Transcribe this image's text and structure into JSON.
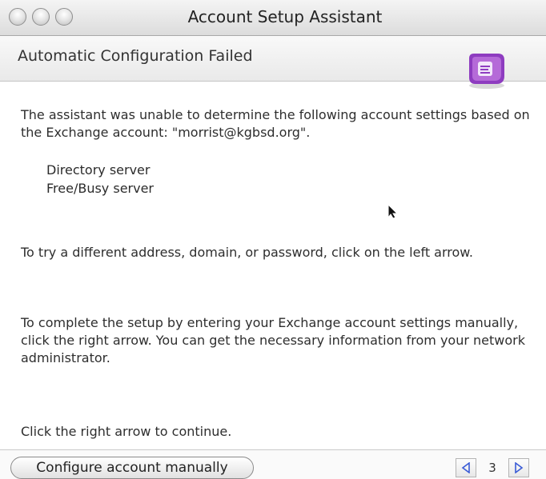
{
  "window": {
    "title": "Account Setup Assistant"
  },
  "step": {
    "title": "Automatic Configuration Failed",
    "icon": "entourage-app-icon"
  },
  "content": {
    "intro": "The assistant was unable to determine the following account settings based on the Exchange account: \"morrist@kgbsd.org\".",
    "settings": [
      "Directory server",
      "Free/Busy server"
    ],
    "try_different": "To try a different address, domain, or password, click on the left arrow.",
    "manual_setup": "To complete the setup by entering your Exchange account settings manually, click the right arrow. You can get the necessary information from your network administrator.",
    "continue": "Click the right arrow to continue."
  },
  "footer": {
    "configure_button": "Configure account manually",
    "page_number": "3"
  },
  "colors": {
    "accent": "#9b3fc3",
    "nav_arrow": "#3a5bd6"
  }
}
